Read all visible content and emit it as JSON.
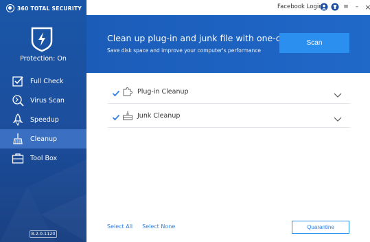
{
  "app": {
    "logo_text": "360 TOTAL SECURITY",
    "protection_status": "Protection: On",
    "version": "8.2.0.1120"
  },
  "topbar": {
    "login_label": "Facebook Login",
    "icons": [
      "user-icon",
      "shirt-icon",
      "menu-icon",
      "minimize-icon",
      "close-icon"
    ],
    "menu_glyph": "≡",
    "minimize_glyph": "–",
    "close_glyph": "×"
  },
  "sidebar": {
    "items": [
      {
        "label": "Full Check",
        "icon": "check-box-icon",
        "active": false
      },
      {
        "label": "Virus Scan",
        "icon": "virus-scan-icon",
        "active": false
      },
      {
        "label": "Speedup",
        "icon": "rocket-icon",
        "active": false
      },
      {
        "label": "Cleanup",
        "icon": "broom-icon",
        "active": true
      },
      {
        "label": "Tool Box",
        "icon": "toolbox-icon",
        "active": false
      }
    ]
  },
  "banner": {
    "title": "Clean up plug-in and junk file with one-click",
    "subtitle": "Save disk space and improve your computer's performance",
    "scan_label": "Scan"
  },
  "cleanup_list": [
    {
      "label": "Plug-in Cleanup",
      "checked": true,
      "icon": "puzzle-icon"
    },
    {
      "label": "Junk Cleanup",
      "checked": true,
      "icon": "trash-tray-icon"
    }
  ],
  "footer": {
    "select_all": "Select All",
    "select_none": "Select None",
    "quarantine": "Quarantine"
  },
  "colors": {
    "sidebar": "#1c4e9c",
    "sidebar_active": "#3a6fc1",
    "banner": "#1e63c2",
    "scan_button": "#2b8ff0",
    "link": "#2b7de3",
    "check": "#2b7de3"
  }
}
